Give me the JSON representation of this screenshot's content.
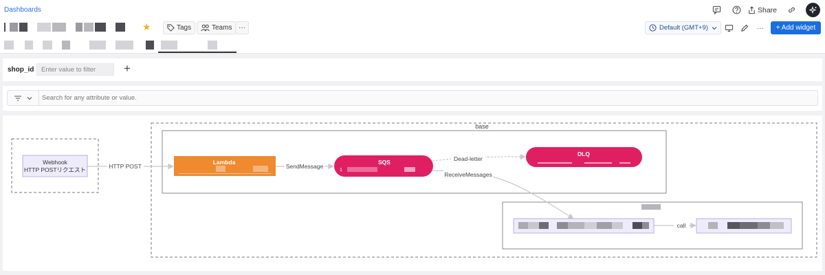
{
  "header": {
    "breadcrumb": "Dashboards",
    "tags_label": "Tags",
    "teams_label": "Teams",
    "more_label": "···",
    "share_label": "Share",
    "timezone_label": "Default (GMT+9)",
    "add_widget_label": "+ Add widget"
  },
  "filter": {
    "label": "shop_id",
    "placeholder": "Enter value to filter",
    "add_label": "+"
  },
  "search": {
    "placeholder": "Search for any attribute or value."
  },
  "diagram": {
    "group_base_label": "base",
    "nodes": {
      "webhook_title": "Webhook",
      "webhook_subtitle": "HTTP POSTリクエスト",
      "lambda": "Lambda",
      "sqs": "SQS",
      "sqs_count": "1",
      "dlq": "DLQ"
    },
    "edges": {
      "http_post": "HTTP POST",
      "send_message": "SendMessage",
      "dead_letter": "Dead-letter",
      "receive_messages": "ReceiveMessages",
      "call": "call"
    }
  },
  "colors": {
    "link": "#2b6fd6",
    "accent": "#1a6ee0",
    "star": "#f2b01e",
    "lambda": "#ef8a2e",
    "sqs": "#e01f62",
    "dlq": "#e01f62",
    "node_box": "#eeecfb"
  }
}
